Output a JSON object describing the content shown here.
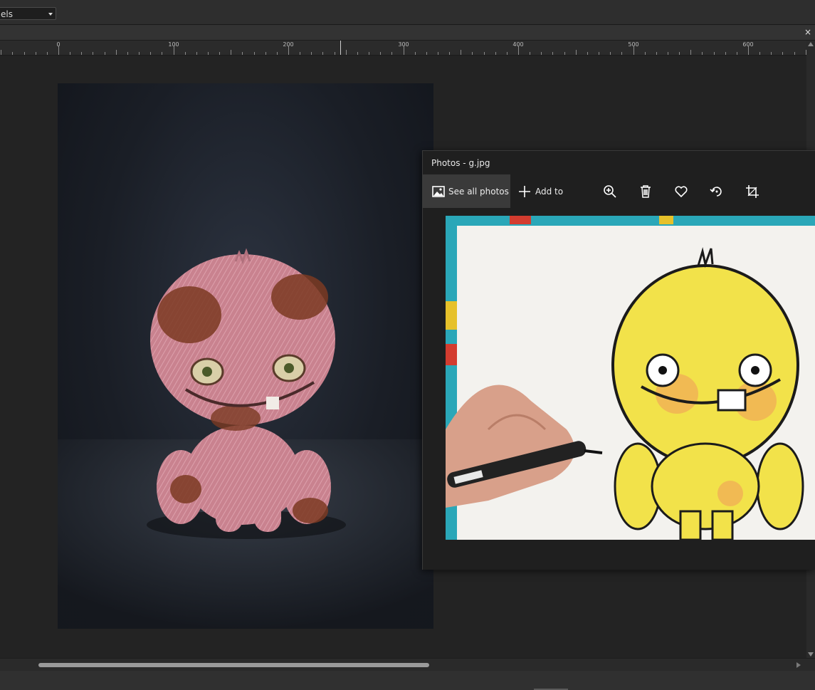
{
  "toolbar": {
    "units_value": "els"
  },
  "tabs": {
    "close_glyph": "×"
  },
  "ruler": {
    "labels": [
      "0",
      "100",
      "200",
      "300",
      "400",
      "500",
      "600"
    ]
  },
  "photos_window": {
    "title": "Photos - g.jpg",
    "see_all_label": "See all photos",
    "add_to_label": "Add to",
    "icons": [
      "image-icon",
      "plus-icon",
      "zoom-in-icon",
      "trash-icon",
      "heart-icon",
      "rotate-icon",
      "crop-icon"
    ]
  },
  "colors": {
    "app_bg": "#252525",
    "monster_pink": "#c9828f",
    "monster_brown": "#7b3a22",
    "drawing_yellow": "#f2e24a",
    "drawing_orange": "#f0a05a"
  }
}
